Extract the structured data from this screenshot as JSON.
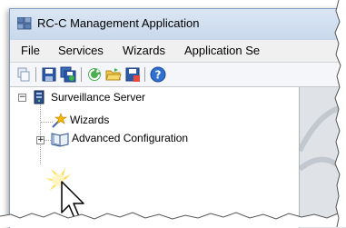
{
  "window": {
    "title": "RC-C Management Application"
  },
  "menu": {
    "items": [
      "File",
      "Services",
      "Wizards",
      "Application Se"
    ]
  },
  "toolbar": {
    "icons": [
      "copy-icon",
      "save-icon",
      "save-all-icon",
      "refresh-icon",
      "open-folder-icon",
      "save-as-icon",
      "help-icon"
    ]
  },
  "tree": {
    "root": {
      "label": "Surveillance Server",
      "expander": "−"
    },
    "children": [
      {
        "label": "Wizards"
      },
      {
        "label": "Advanced Configuration",
        "expander": "+"
      }
    ]
  },
  "colors": {
    "title_bar": "#c8d8ec",
    "menu_bar": "#f0f0f0",
    "right_pane": "#dfe3e8"
  }
}
